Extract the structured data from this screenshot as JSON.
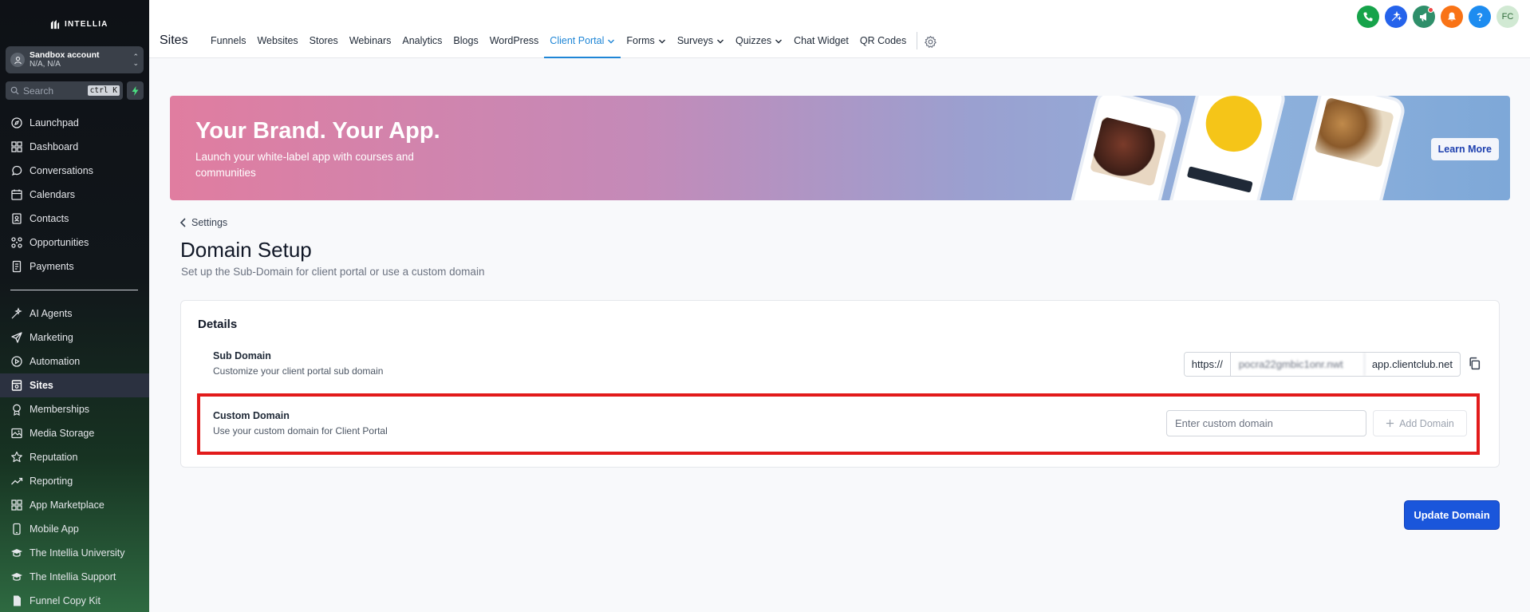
{
  "sidebar": {
    "logo_text": "INTELLIA",
    "account": {
      "name": "Sandbox account",
      "location": "N/A, N/A"
    },
    "search": {
      "placeholder": "Search",
      "shortcut": "ctrl K"
    },
    "items": [
      {
        "label": "Launchpad",
        "icon": "launchpad-icon"
      },
      {
        "label": "Dashboard",
        "icon": "dashboard-icon"
      },
      {
        "label": "Conversations",
        "icon": "chat-icon"
      },
      {
        "label": "Calendars",
        "icon": "calendar-icon"
      },
      {
        "label": "Contacts",
        "icon": "contacts-icon"
      },
      {
        "label": "Opportunities",
        "icon": "opportunities-icon"
      },
      {
        "label": "Payments",
        "icon": "payments-icon"
      }
    ],
    "items2": [
      {
        "label": "AI Agents",
        "icon": "ai-agents-icon"
      },
      {
        "label": "Marketing",
        "icon": "send-icon"
      },
      {
        "label": "Automation",
        "icon": "automation-icon"
      },
      {
        "label": "Sites",
        "icon": "sites-icon",
        "active": true
      },
      {
        "label": "Memberships",
        "icon": "memberships-icon"
      },
      {
        "label": "Media Storage",
        "icon": "media-icon"
      },
      {
        "label": "Reputation",
        "icon": "star-icon"
      },
      {
        "label": "Reporting",
        "icon": "reporting-icon"
      },
      {
        "label": "App Marketplace",
        "icon": "marketplace-icon"
      },
      {
        "label": "Mobile App",
        "icon": "mobile-icon"
      },
      {
        "label": "The Intellia University",
        "icon": "university-icon"
      },
      {
        "label": "The Intellia Support",
        "icon": "support-icon"
      },
      {
        "label": "Funnel Copy Kit",
        "icon": "document-icon"
      }
    ]
  },
  "topbar": {
    "title": "Sites",
    "tabs": [
      {
        "label": "Funnels"
      },
      {
        "label": "Websites"
      },
      {
        "label": "Stores"
      },
      {
        "label": "Webinars"
      },
      {
        "label": "Analytics"
      },
      {
        "label": "Blogs"
      },
      {
        "label": "WordPress"
      },
      {
        "label": "Client Portal",
        "active": true,
        "dropdown": true
      },
      {
        "label": "Forms",
        "dropdown": true
      },
      {
        "label": "Surveys",
        "dropdown": true
      },
      {
        "label": "Quizzes",
        "dropdown": true
      },
      {
        "label": "Chat Widget"
      },
      {
        "label": "QR Codes"
      }
    ],
    "user_initials": "FC",
    "colors": {
      "phone": "#16a34a",
      "tasks": "#2563eb",
      "announce": "#2f8f6a",
      "notify": "#f97316",
      "help": "#1d8cf0",
      "active_tab": "#1f86d6"
    }
  },
  "banner": {
    "title": "Your Brand. Your App.",
    "subtitle": "Launch your white-label app with courses and communities",
    "cta": "Learn More"
  },
  "page": {
    "back_label": "Settings",
    "title": "Domain Setup",
    "subtitle": "Set up the Sub-Domain for client portal or use a custom domain"
  },
  "details": {
    "title": "Details",
    "sub_domain": {
      "label": "Sub Domain",
      "description": "Customize your client portal sub domain",
      "prefix": "https://",
      "value": "pocra22gmbic1onr.nwt",
      "suffix": "app.clientclub.net"
    },
    "custom_domain": {
      "label": "Custom Domain",
      "description": "Use your custom domain for Client Portal",
      "placeholder": "Enter custom domain",
      "add_label": "Add Domain"
    }
  },
  "actions": {
    "update_label": "Update Domain"
  },
  "accent": {
    "highlight": "#e21b1b",
    "primary": "#1a56db"
  }
}
